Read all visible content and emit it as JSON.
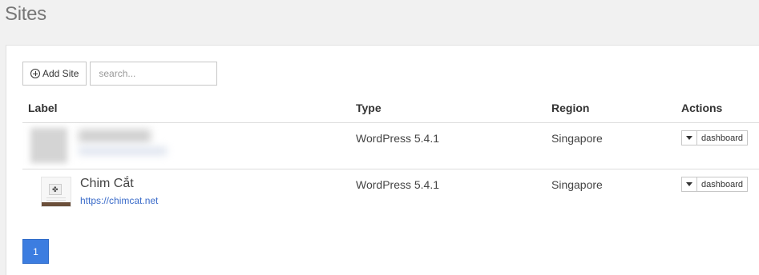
{
  "page": {
    "title": "Sites"
  },
  "toolbar": {
    "add_site_label": "Add Site",
    "search_placeholder": "search..."
  },
  "table": {
    "columns": [
      "Label",
      "Type",
      "Region",
      "Actions"
    ],
    "rows": [
      {
        "name": "",
        "url": "",
        "type": "WordPress 5.4.1",
        "region": "Singapore",
        "action": "dashboard",
        "redacted": true
      },
      {
        "name": "Chim Cắt",
        "url": "https://chimcat.net",
        "type": "WordPress 5.4.1",
        "region": "Singapore",
        "action": "dashboard",
        "redacted": false
      }
    ]
  },
  "pagination": {
    "current_page": "1"
  },
  "colors": {
    "accent": "#3c7de0",
    "link": "#3a6bc9",
    "thumb_bar": "#6b4f3a"
  }
}
